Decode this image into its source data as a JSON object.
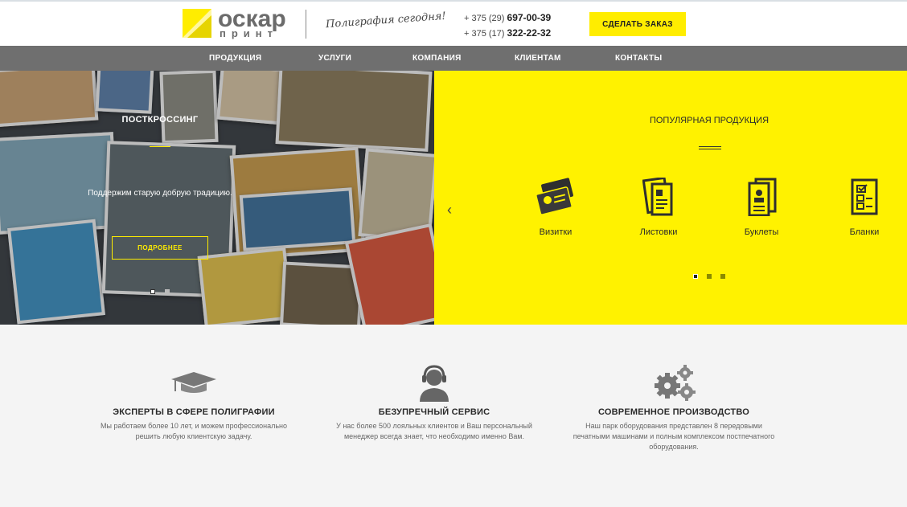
{
  "header": {
    "logo_word1": "оскар",
    "logo_word2": "принт",
    "slogan": "Полиграфия сегодня!",
    "phone1_prefix": "+ 375 (29)",
    "phone1_number": "697-00-39",
    "phone2_prefix": "+ 375 (17)",
    "phone2_number": "322-22-32",
    "order_button": "СДЕЛАТЬ ЗАКАЗ"
  },
  "nav": {
    "items": [
      {
        "label": "ПРОДУКЦИЯ"
      },
      {
        "label": "УСЛУГИ"
      },
      {
        "label": "КОМПАНИЯ"
      },
      {
        "label": "КЛИЕНТАМ"
      },
      {
        "label": "КОНТАКТЫ"
      }
    ]
  },
  "slider": {
    "title": "ПОСТКРОССИНГ",
    "text": "Поддержим старую добрую традицию.",
    "button": "ПОДРОБНЕЕ",
    "active_slide": 1,
    "slide_count": 2
  },
  "popular": {
    "title": "ПОПУЛЯРНАЯ ПРОДУКЦИЯ",
    "items": [
      {
        "label": "Визитки",
        "icon": "business-cards-icon"
      },
      {
        "label": "Листовки",
        "icon": "leaflet-icon"
      },
      {
        "label": "Буклеты",
        "icon": "booklet-icon"
      },
      {
        "label": "Бланки",
        "icon": "form-icon"
      }
    ],
    "active_page": 1,
    "page_count": 3
  },
  "features": [
    {
      "title": "ЭКСПЕРТЫ В СФЕРЕ ПОЛИГРАФИИ",
      "text": "Мы работаем более 10 лет, и можем профессионально решить любую клиентскую задачу.",
      "icon": "graduation-cap-icon"
    },
    {
      "title": "БЕЗУПРЕЧНЫЙ СЕРВИС",
      "text": "У нас более 500 лояльных клиентов и Ваш персональный менеджер всегда знает, что необходимо именно Вам.",
      "icon": "support-operator-icon"
    },
    {
      "title": "СОВРЕМЕННОЕ ПРОИЗВОДСТВО",
      "text": "Наш парк оборудования представлен 8 передовыми печатными машинами и полным комплексом постпечатного оборудования.",
      "icon": "gears-icon"
    }
  ],
  "colors": {
    "accent": "#ffed00",
    "nav_bg": "#6f6f6f",
    "page_bg": "#f4f4f4"
  }
}
